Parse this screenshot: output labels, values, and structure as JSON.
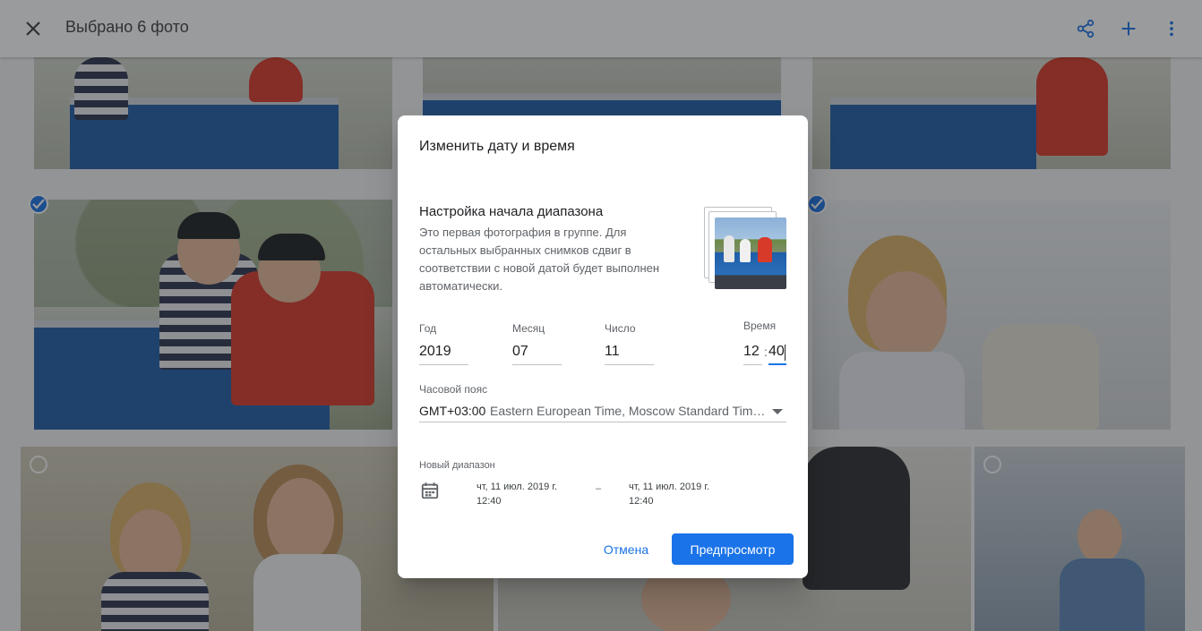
{
  "topbar": {
    "title": "Выбрано 6 фото",
    "icons": [
      "close-icon",
      "share-icon",
      "add-icon",
      "more-vert-icon"
    ]
  },
  "gallery": {
    "selection": [
      "selected",
      "selected",
      "unselected",
      "unselected"
    ]
  },
  "dialog": {
    "title": "Изменить дату и время",
    "subtitle": "Настройка начала диапазона",
    "description": "Это первая фотография в группе. Для остальных выбранных снимков сдвиг в соответствии с новой датой будет выполнен автоматически.",
    "fields": {
      "year": {
        "label": "Год",
        "value": "2019"
      },
      "month": {
        "label": "Месяц",
        "value": "07"
      },
      "day": {
        "label": "Число",
        "value": "11"
      },
      "time": {
        "label": "Время",
        "hours": "12",
        "separator": ":",
        "minutes": "40"
      }
    },
    "timezone": {
      "label": "Часовой пояс",
      "offset": "GMT+03:00",
      "name": "Eastern European Time, Moscow Standard Time…"
    },
    "new_range": {
      "label": "Новый диапазон",
      "start_date": "чт, 11 июл. 2019 г.",
      "start_time": "12:40",
      "separator": "–",
      "end_date": "чт, 11 июл. 2019 г.",
      "end_time": "12:40"
    },
    "buttons": {
      "cancel": "Отмена",
      "preview": "Предпросмотр"
    },
    "colors": {
      "accent": "#1a73e8"
    }
  }
}
